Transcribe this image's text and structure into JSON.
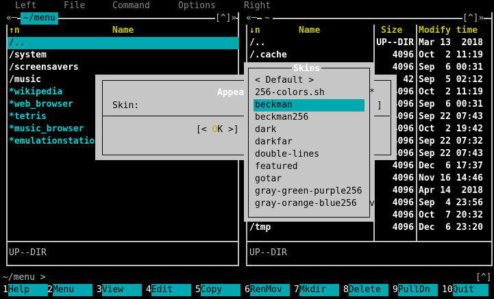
{
  "menu": {
    "left": "Left",
    "file": "File",
    "command": "Command",
    "options": "Options",
    "right": "Right"
  },
  "left_panel": {
    "path": "~/menu",
    "corner_left": "«─",
    "corner_right": "[^]»",
    "col_sort": "↑n",
    "col_name": "Name",
    "rows": [
      "/..",
      "/system",
      "/screensavers",
      "/music",
      "*wikipedia",
      "*web_browser",
      "*tetris",
      "*music_browser",
      "*emulationstation"
    ],
    "status": "UP--DIR"
  },
  "right_panel": {
    "path": "~",
    "corner_left": "«─",
    "corner_right": "[^]»",
    "col_sort": "↓n",
    "col_name": "Name",
    "col_size": "Size",
    "col_time": "Modify time",
    "rows": [
      {
        "name": "/..",
        "size": "UP--DIR",
        "time": "Mar 13  2018"
      },
      {
        "name": "/.cache",
        "size": "4096",
        "time": "Oct  2 11:19"
      },
      {
        "name": "",
        "size": "4096",
        "time": "Sep  6 00:31"
      },
      {
        "name": "",
        "size": "42",
        "time": "Sep  5 02:12"
      },
      {
        "name": "",
        "size": "4096",
        "time": "Oct  2 11:19"
      },
      {
        "name": "",
        "size": "4096",
        "time": "Sep  6 00:31"
      },
      {
        "name": "",
        "size": "4096",
        "time": "Sep 22 07:43"
      },
      {
        "name": "",
        "size": "4096",
        "time": "Oct  2 19:42"
      },
      {
        "name": "",
        "size": "4096",
        "time": "Sep 22 07:32"
      },
      {
        "name": "",
        "size": "4096",
        "time": "Sep 22 07:43"
      },
      {
        "name": "",
        "size": "4096",
        "time": "Dec  6 17:37"
      },
      {
        "name": "",
        "size": "4096",
        "time": "Nov 16 14:46"
      },
      {
        "name": "",
        "size": "4096",
        "time": "Apr 14  2018"
      },
      {
        "name": "",
        "size": "4096",
        "time": "Sep  4 23:56"
      },
      {
        "name": "",
        "size": "4096",
        "time": "Oct  7 20:32"
      },
      {
        "name": "/tmp",
        "size": "4096",
        "time": "Dec  6 23:20"
      }
    ],
    "status": "UP--DIR"
  },
  "appearance_dialog": {
    "title": "Appea",
    "skin_label": "Skin:",
    "ok": "[< OK >]"
  },
  "skins_list": {
    "title": "Skins",
    "items": [
      "< Default >",
      "256-colors.sh",
      "beckman",
      "beckman256",
      "dark",
      "darkfar",
      "double-lines",
      "featured",
      "gotar",
      "gray-green-purple256",
      "gray-orange-blue256"
    ],
    "selected": "beckman",
    "star": "*",
    "more": "v"
  },
  "command_line": "~/menu >",
  "corner": "[^]",
  "fkeys": [
    {
      "n": "1",
      "l": "Help"
    },
    {
      "n": "2",
      "l": "Menu"
    },
    {
      "n": "3",
      "l": "View"
    },
    {
      "n": "4",
      "l": "Edit"
    },
    {
      "n": "5",
      "l": "Copy"
    },
    {
      "n": "6",
      "l": "RenMov"
    },
    {
      "n": "7",
      "l": "Mkdir"
    },
    {
      "n": "8",
      "l": "Delete"
    },
    {
      "n": "9",
      "l": "PullDn"
    },
    {
      "n": "10",
      "l": "Quit"
    }
  ],
  "colors": {
    "accent": "#00a8b0",
    "header": "#c8c800",
    "dir": "#ffffff",
    "exec": "#00d7d7",
    "dialog": "#c6c6c6"
  }
}
